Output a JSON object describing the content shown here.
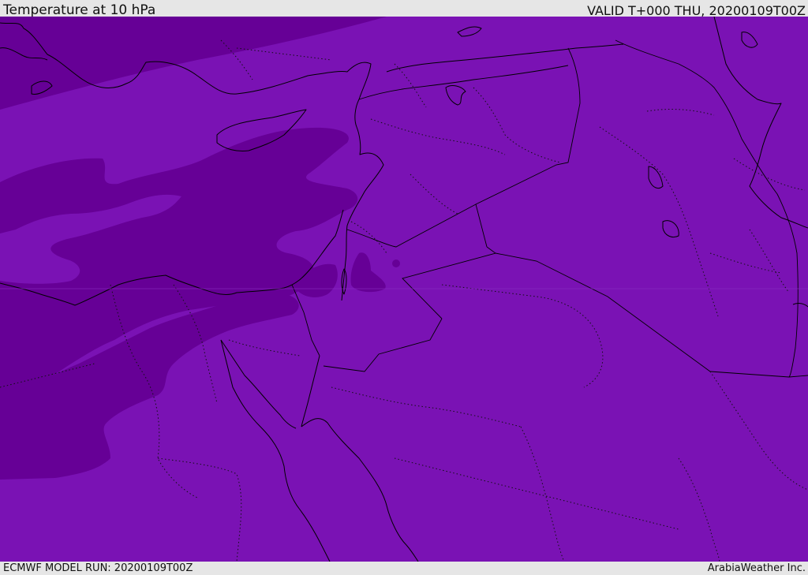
{
  "header": {
    "title": "Temperature at 10 hPa",
    "valid": "VALID T+000 THU, 20200109T00Z"
  },
  "footer": {
    "model_run": "ECMWF MODEL RUN: 20200109T00Z",
    "brand": "ArabiaWeather Inc."
  },
  "colors": {
    "field_base": "#7a12b4",
    "field_cold": "#660096",
    "lines": "#000000",
    "chrome": "#e6e6e6"
  },
  "map": {
    "region": "Eastern Mediterranean and Middle East",
    "variable": "temperature",
    "level": "10 hPa"
  }
}
